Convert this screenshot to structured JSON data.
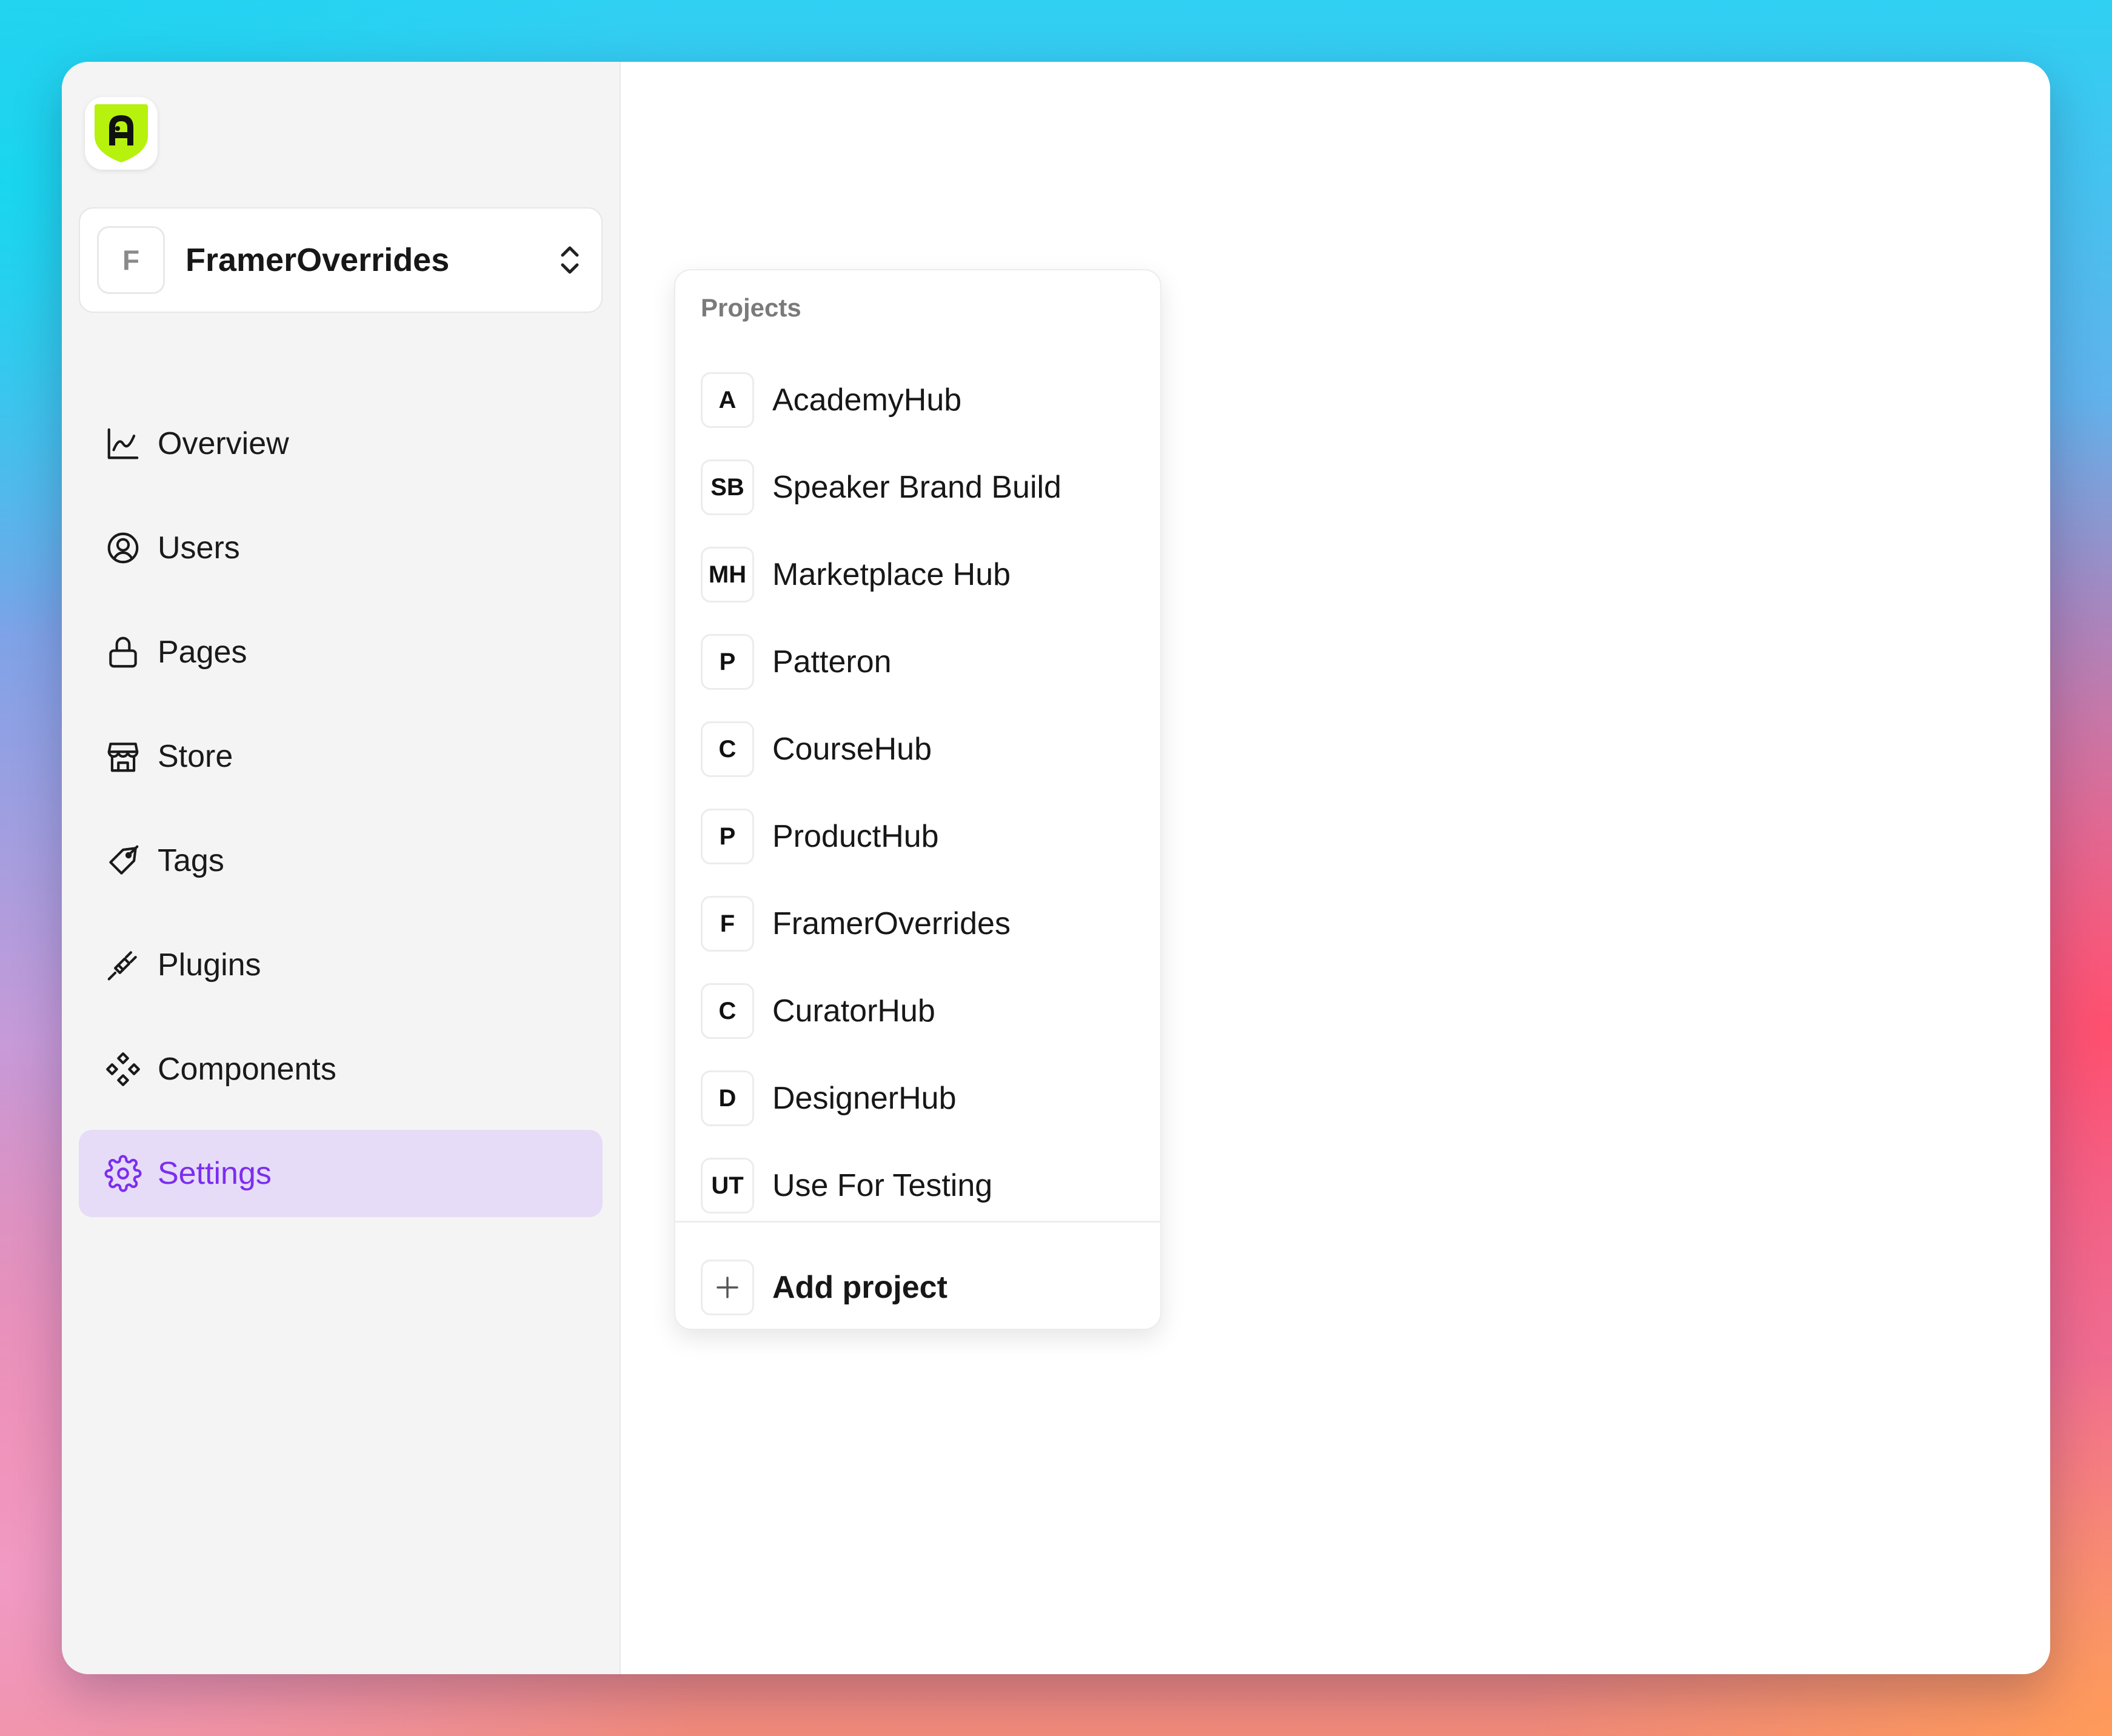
{
  "switcher": {
    "initial": "F",
    "name": "FramerOverrides"
  },
  "nav": [
    {
      "label": "Overview",
      "icon": "chart-line-icon"
    },
    {
      "label": "Users",
      "icon": "user-circle-icon"
    },
    {
      "label": "Pages",
      "icon": "lock-icon"
    },
    {
      "label": "Store",
      "icon": "store-icon"
    },
    {
      "label": "Tags",
      "icon": "tag-icon"
    },
    {
      "label": "Plugins",
      "icon": "plug-icon"
    },
    {
      "label": "Components",
      "icon": "components-icon"
    },
    {
      "label": "Settings",
      "icon": "gear-icon",
      "active": true
    }
  ],
  "projects": {
    "header": "Projects",
    "items": [
      {
        "initials": "A",
        "name": "AcademyHub"
      },
      {
        "initials": "SB",
        "name": "Speaker Brand Build"
      },
      {
        "initials": "MH",
        "name": "Marketplace Hub"
      },
      {
        "initials": "P",
        "name": "Patteron"
      },
      {
        "initials": "C",
        "name": "CourseHub"
      },
      {
        "initials": "P",
        "name": "ProductHub"
      },
      {
        "initials": "F",
        "name": "FramerOverrides"
      },
      {
        "initials": "C",
        "name": "CuratorHub"
      },
      {
        "initials": "D",
        "name": "DesignerHub"
      },
      {
        "initials": "UT",
        "name": "Use For Testing"
      }
    ],
    "add_label": "Add project"
  },
  "colors": {
    "accent": "#7c2df0",
    "active_bg": "#e6dcf7",
    "logo": "#b6f20d"
  }
}
